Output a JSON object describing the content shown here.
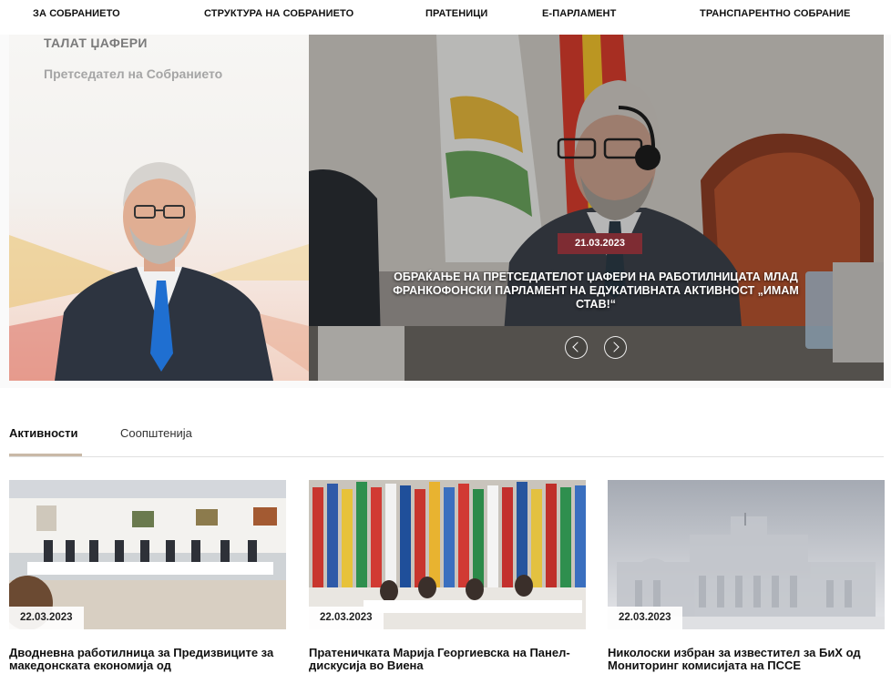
{
  "nav": {
    "items": [
      "ЗА СОБРАНИЕТО",
      "СТРУКТУРА НА СОБРАНИЕТО",
      "ПРАТЕНИЦИ",
      "Е-ПАРЛАМЕНТ",
      "ТРАНСПАРЕНТНО СОБРАНИЕ"
    ]
  },
  "speaker": {
    "name": "ТАЛАТ ЏАФЕРИ",
    "title": "Претседател на Собранието"
  },
  "carousel": {
    "date": "21.03.2023",
    "title": "ОБРАЌАЊЕ НА ПРЕТСЕДАТЕЛОТ ЏАФЕРИ НА РАБОТИЛНИЦАТА МЛАД ФРАНКОФОНСКИ ПАРЛАМЕНТ НА ЕДУКАТИВНАТА АКТИВНОСТ „ИМАМ СТАВ!“",
    "prev_icon": "chevron-left-icon",
    "next_icon": "chevron-right-icon"
  },
  "tabs": {
    "items": [
      "Активности",
      "Соопштенија"
    ],
    "active": "Активности"
  },
  "cards": [
    {
      "date": "22.03.2023",
      "title": "Дводневна работилница за Предизвиците за македонската економија од"
    },
    {
      "date": "22.03.2023",
      "title": "Пратеничката Марија Георгиевска на Панел-дискусија во Виена"
    },
    {
      "date": "22.03.2023",
      "title": "Николоски избран за известител за БиХ од Мониторинг комисијата на ПССЕ"
    }
  ],
  "colors": {
    "accent": "#7e2c33",
    "tab_underline": "#c9b9a7"
  }
}
